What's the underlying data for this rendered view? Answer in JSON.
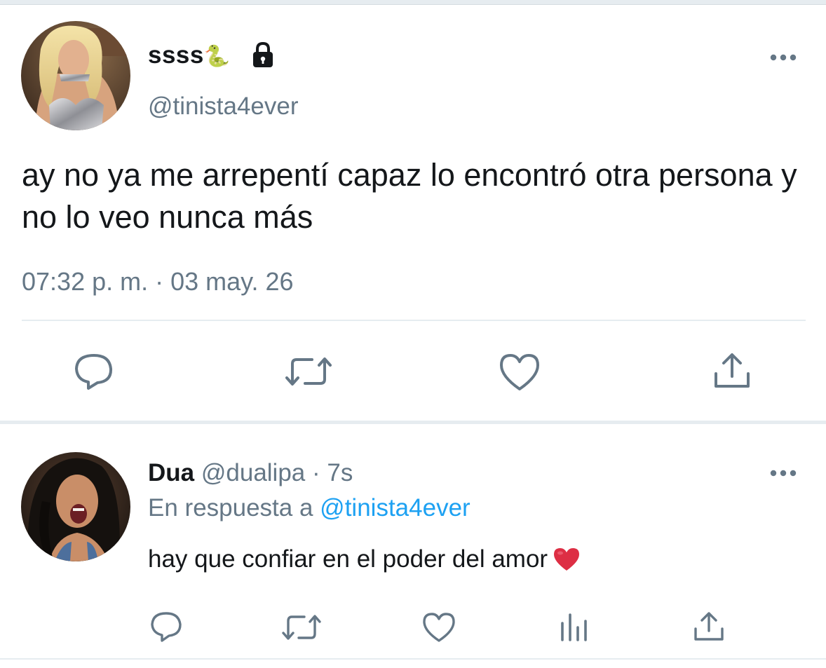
{
  "main_tweet": {
    "display_name": "ssss",
    "name_emoji": "🐍",
    "protected": true,
    "handle": "@tinista4ever",
    "text": "ay no ya me arrepentí capaz lo encontró otra persona y no lo veo nunca más",
    "timestamp": "07:32 p. m. · 03 may. 26",
    "actions": [
      "reply",
      "retweet",
      "like",
      "share"
    ],
    "more_icon": "more-dots-icon"
  },
  "reply": {
    "display_name": "Dua",
    "handle": "@dualipa",
    "separator": "·",
    "time": "7s",
    "reply_to_label": "En respuesta a",
    "reply_to_handle": "@tinista4ever",
    "text": "hay que confiar en el poder del amor",
    "emoji": "red-heart-emoji",
    "actions": [
      "reply",
      "retweet",
      "like",
      "analytics",
      "share"
    ]
  },
  "colors": {
    "text": "#14171a",
    "secondary": "#657786",
    "link": "#1da1f2",
    "divider": "#e6ecf0",
    "icon": "#657786"
  }
}
